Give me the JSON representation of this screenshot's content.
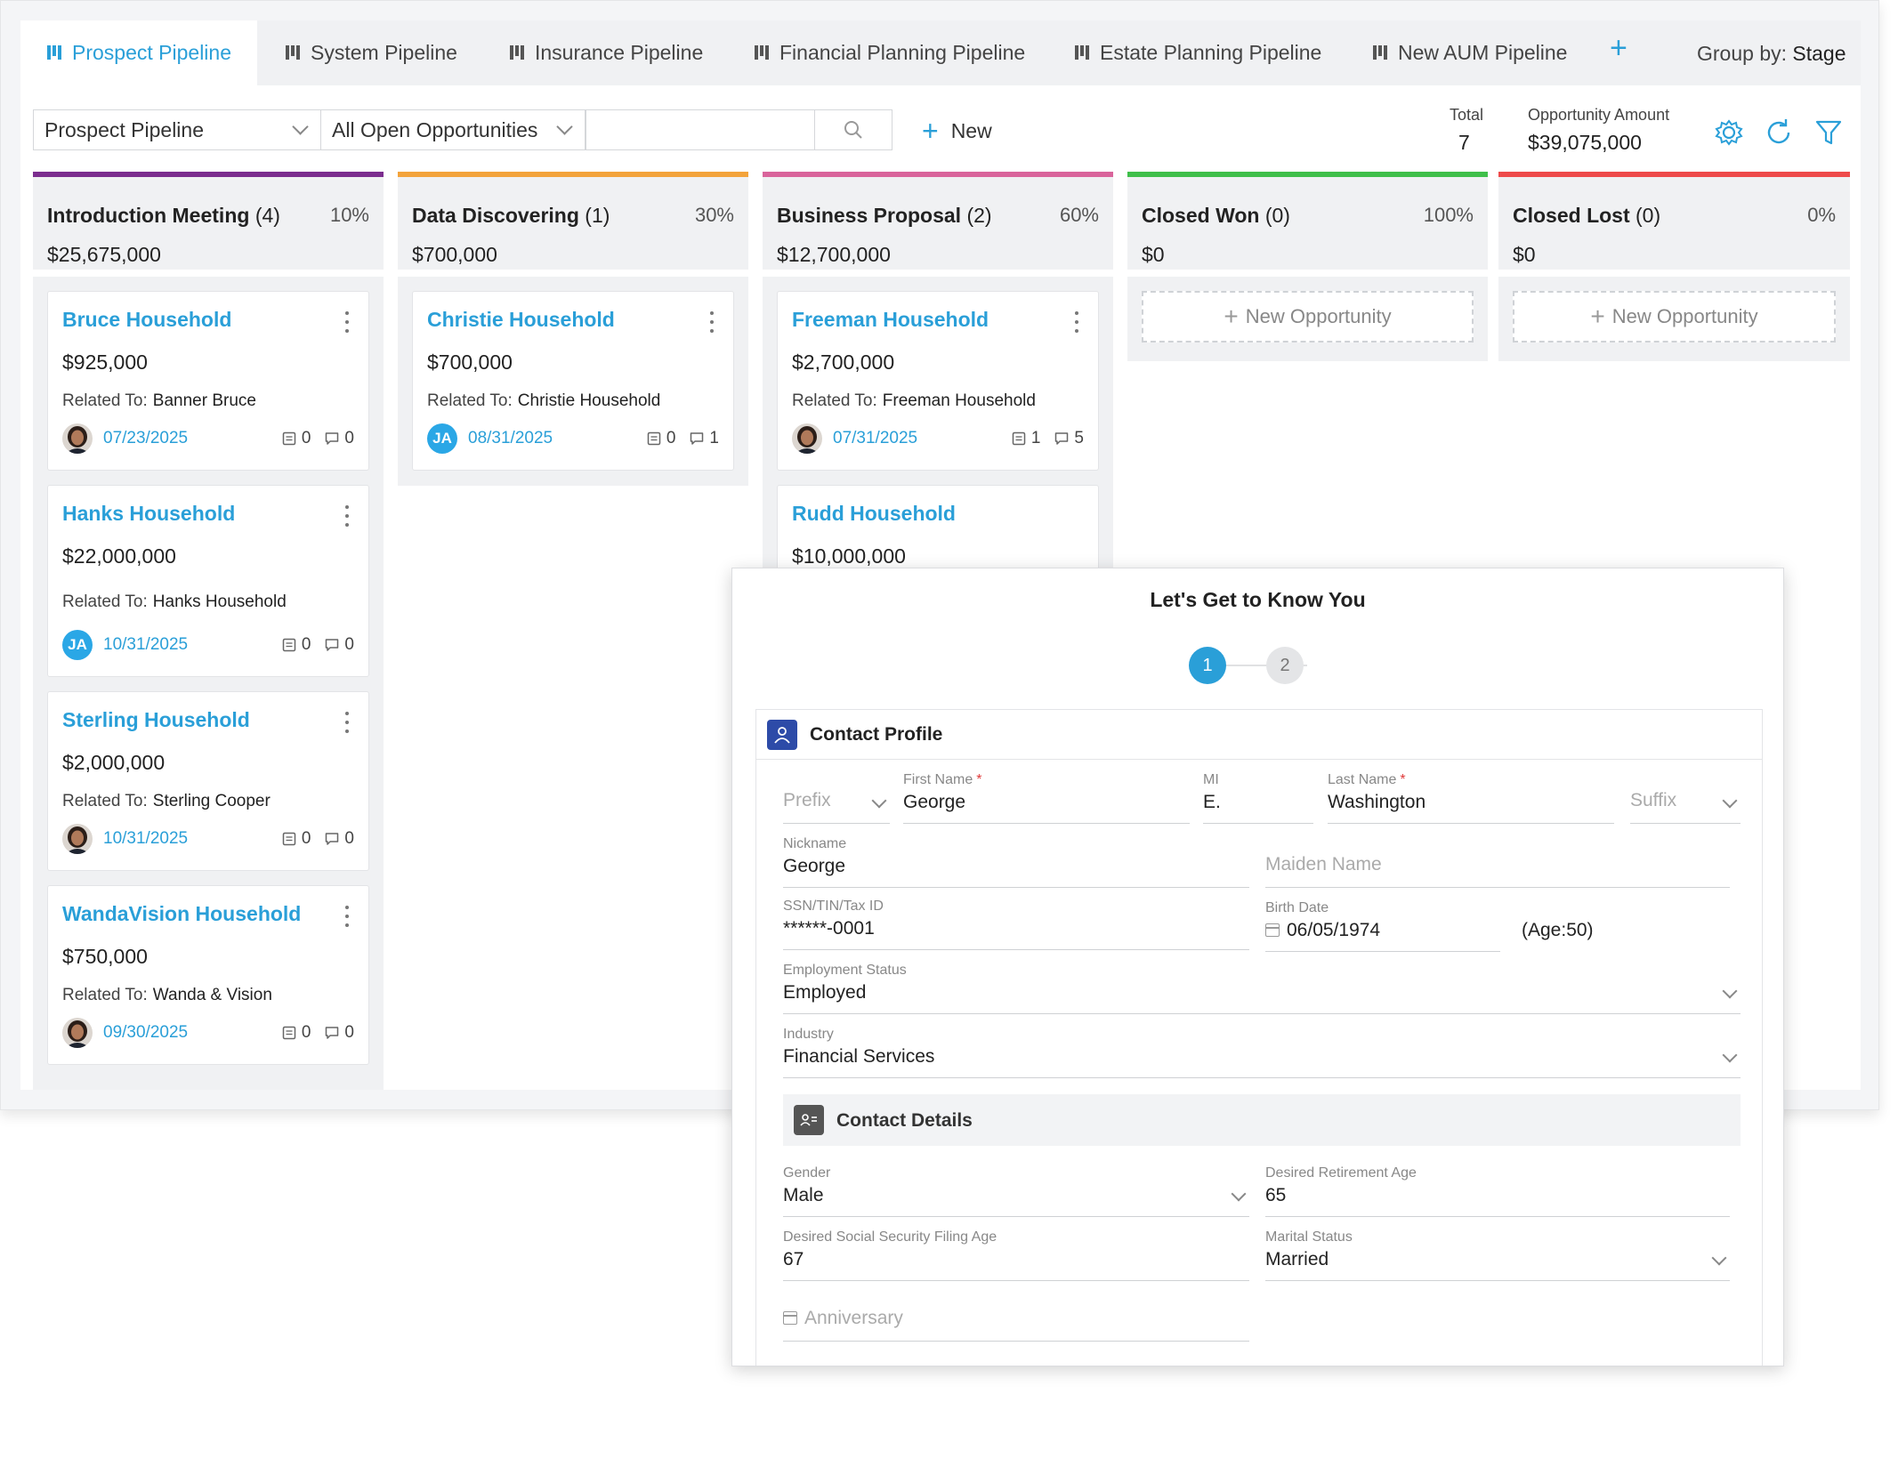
{
  "tabs": [
    {
      "label": "Prospect Pipeline",
      "active": true
    },
    {
      "label": "System Pipeline"
    },
    {
      "label": "Insurance Pipeline"
    },
    {
      "label": "Financial Planning Pipeline"
    },
    {
      "label": "Estate Planning Pipeline"
    },
    {
      "label": "New AUM Pipeline"
    }
  ],
  "add_tab": "+",
  "group_by": {
    "label": "Group by:",
    "value": "Stage"
  },
  "toolbar": {
    "pipeline_select": "Prospect Pipeline",
    "filter_select": "All Open Opportunities",
    "search_placeholder": "",
    "new_label": "New",
    "total_label": "Total",
    "total_value": "7",
    "amount_label": "Opportunity Amount",
    "amount_value": "$39,075,000"
  },
  "colors": {
    "accent": "#2a9fd8",
    "stage1": "#7b2d8e",
    "stage2": "#f3a33b",
    "stage3": "#d9649b",
    "stage4": "#3fbf4a",
    "stage5": "#ee4a4a"
  },
  "columns": [
    {
      "title": "Introduction Meeting",
      "count": "(4)",
      "pct": "10%",
      "amount": "$25,675,000"
    },
    {
      "title": "Data Discovering",
      "count": "(1)",
      "pct": "30%",
      "amount": "$700,000"
    },
    {
      "title": "Business Proposal",
      "count": "(2)",
      "pct": "60%",
      "amount": "$12,700,000"
    },
    {
      "title": "Closed Won",
      "count": "(0)",
      "pct": "100%",
      "amount": "$0"
    },
    {
      "title": "Closed Lost",
      "count": "(0)",
      "pct": "0%",
      "amount": "$0"
    }
  ],
  "related_label": "Related To:",
  "cards": [
    {
      "title": "Bruce Household",
      "amount": "$925,000",
      "related": "Banner Bruce",
      "avatar": "photo",
      "date": "07/23/2025",
      "tasks": "0",
      "notes": "0"
    },
    {
      "title": "Hanks Household",
      "amount": "$22,000,000",
      "related": "Hanks Household",
      "avatar": "JA",
      "date": "10/31/2025",
      "tasks": "0",
      "notes": "0"
    },
    {
      "title": "Sterling Household",
      "amount": "$2,000,000",
      "related": "Sterling Cooper",
      "avatar": "photo",
      "date": "10/31/2025",
      "tasks": "0",
      "notes": "0"
    },
    {
      "title": "WandaVision Household",
      "amount": "$750,000",
      "related": "Wanda & Vision",
      "avatar": "photo",
      "date": "09/30/2025",
      "tasks": "0",
      "notes": "0"
    },
    {
      "title": "Christie Household",
      "amount": "$700,000",
      "related": "Christie Household",
      "avatar": "JA",
      "date": "08/31/2025",
      "tasks": "0",
      "notes": "1"
    },
    {
      "title": "Freeman Household",
      "amount": "$2,700,000",
      "related": "Freeman Household",
      "avatar": "photo",
      "date": "07/31/2025",
      "tasks": "1",
      "notes": "5"
    },
    {
      "title": "Rudd Household",
      "amount": "$10,000,000"
    }
  ],
  "new_opportunity": "New Opportunity",
  "modal": {
    "title": "Let's Get to Know You",
    "steps": [
      "1",
      "2"
    ],
    "section_title": "Contact Profile",
    "subsection_title": "Contact Details",
    "fields": {
      "prefix": {
        "placeholder": "Prefix"
      },
      "first_name": {
        "label": "First Name",
        "required": "*",
        "value": "George"
      },
      "mi": {
        "label": "MI",
        "value": "E."
      },
      "last_name": {
        "label": "Last Name",
        "required": "*",
        "value": "Washington"
      },
      "suffix": {
        "placeholder": "Suffix"
      },
      "nickname": {
        "label": "Nickname",
        "value": "George"
      },
      "maiden_name": {
        "placeholder": "Maiden Name"
      },
      "ssn": {
        "label": "SSN/TIN/Tax ID",
        "value": "******-0001"
      },
      "birth_date": {
        "label": "Birth Date",
        "value": "06/05/1974",
        "age": "(Age:50)"
      },
      "employment_status": {
        "label": "Employment Status",
        "value": "Employed"
      },
      "industry": {
        "label": "Industry",
        "value": "Financial Services"
      },
      "gender": {
        "label": "Gender",
        "value": "Male"
      },
      "retirement_age": {
        "label": "Desired Retirement Age",
        "value": "65"
      },
      "ss_filing_age": {
        "label": "Desired Social Security Filing Age",
        "value": "67"
      },
      "marital_status": {
        "label": "Marital Status",
        "value": "Married"
      },
      "anniversary": {
        "placeholder": "Anniversary"
      }
    }
  }
}
